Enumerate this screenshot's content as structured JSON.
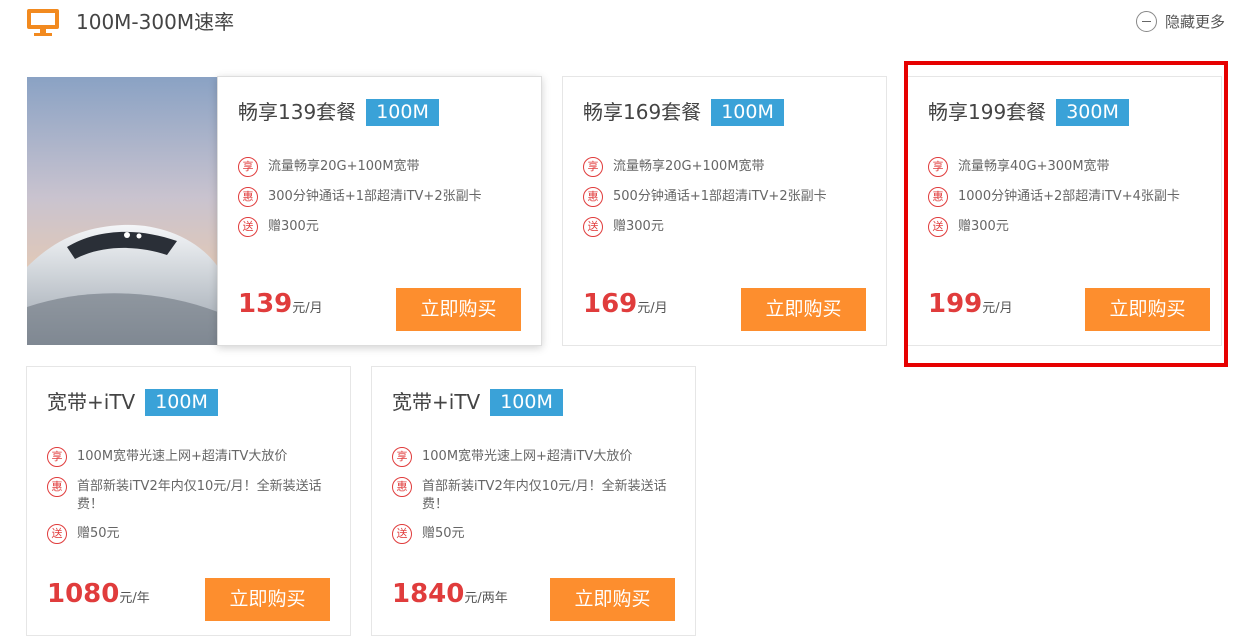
{
  "section": {
    "title": "100M-300M速率",
    "hide_label": "隐藏更多"
  },
  "plans": [
    {
      "name": "畅享139套餐",
      "speed": "100M",
      "features": [
        {
          "icon": "享",
          "text": "流量畅享20G+100M宽带"
        },
        {
          "icon": "惠",
          "text": "300分钟通话+1部超清iTV+2张副卡"
        },
        {
          "icon": "送",
          "text": "赠300元"
        }
      ],
      "price": "139",
      "unit": "元/月",
      "buy_label": "立即购买"
    },
    {
      "name": "畅享169套餐",
      "speed": "100M",
      "features": [
        {
          "icon": "享",
          "text": "流量畅享20G+100M宽带"
        },
        {
          "icon": "惠",
          "text": "500分钟通话+1部超清iTV+2张副卡"
        },
        {
          "icon": "送",
          "text": "赠300元"
        }
      ],
      "price": "169",
      "unit": "元/月",
      "buy_label": "立即购买"
    },
    {
      "name": "畅享199套餐",
      "speed": "300M",
      "features": [
        {
          "icon": "享",
          "text": "流量畅享40G+300M宽带"
        },
        {
          "icon": "惠",
          "text": "1000分钟通话+2部超清iTV+4张副卡"
        },
        {
          "icon": "送",
          "text": "赠300元"
        }
      ],
      "price": "199",
      "unit": "元/月",
      "buy_label": "立即购买"
    },
    {
      "name": "宽带+iTV",
      "speed": "100M",
      "features": [
        {
          "icon": "享",
          "text": "100M宽带光速上网+超清iTV大放价"
        },
        {
          "icon": "惠",
          "text": "首部新装iTV2年内仅10元/月！全新装送话费！"
        },
        {
          "icon": "送",
          "text": "赠50元"
        }
      ],
      "price": "1080",
      "unit": "元/年",
      "buy_label": "立即购买"
    },
    {
      "name": "宽带+iTV",
      "speed": "100M",
      "features": [
        {
          "icon": "享",
          "text": "100M宽带光速上网+超清iTV大放价"
        },
        {
          "icon": "惠",
          "text": "首部新装iTV2年内仅10元/月！全新装送话费！"
        },
        {
          "icon": "送",
          "text": "赠50元"
        }
      ],
      "price": "1840",
      "unit": "元/两年",
      "buy_label": "立即购买"
    }
  ],
  "colors": {
    "accent_orange": "#fd8e2e",
    "price_red": "#e03c3c",
    "badge_blue": "#3aa2d8",
    "highlight_red": "#e60000"
  },
  "icons": {
    "header": "tv-icon",
    "hide": "minus-circle-icon",
    "photo": "high-speed-train-photo"
  }
}
